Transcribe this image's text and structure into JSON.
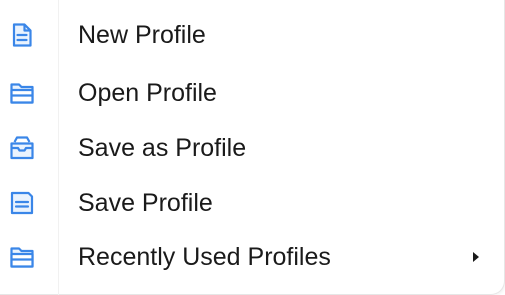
{
  "menu": {
    "accent_color": "#3a86e8",
    "items": [
      {
        "label": "New Profile",
        "icon": "new-document-icon"
      },
      {
        "label": "Open Profile",
        "icon": "open-folder-icon"
      },
      {
        "label": "Save as Profile",
        "icon": "save-as-icon"
      },
      {
        "label": "Save Profile",
        "icon": "save-disk-icon"
      },
      {
        "label": "Recently Used Profiles",
        "icon": "recent-folder-icon",
        "has_submenu": true
      }
    ]
  }
}
